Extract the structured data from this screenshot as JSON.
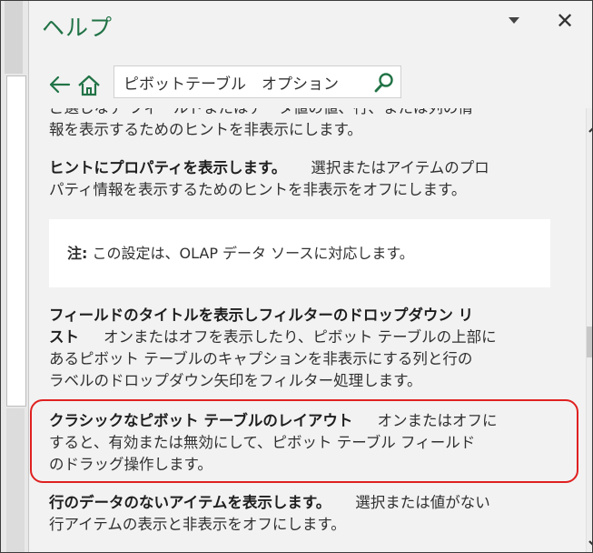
{
  "pane": {
    "title": "ヘルプ"
  },
  "search": {
    "value": "ピボットテーブル　オプション"
  },
  "content": {
    "para_top_line1": "ご選しなデ フィールドまたはデータ値の値、行、または列の情",
    "para_top_line2": "報を表示するためのヒントを非表示にします。",
    "hint_props_title": "ヒントにプロパティを表示します。",
    "hint_props_body_line1": "選択またはアイテムのプロ",
    "hint_props_body_line2": "パティ情報を表示するためのヒントを非表示をオフにします。",
    "note_label": "注:",
    "note_text": "この設定は、OLAP データ ソースに対応します。",
    "field_caption_title_line1": "フィールドのタイトルを表示しフィルターのドロップダウン リ",
    "field_caption_title_line2": "スト",
    "field_caption_body_line1": "オンまたはオフを表示したり、ピボット テーブルの上部に",
    "field_caption_body_line2": "あるピボット テーブルのキャプションを非表示にする列と行の",
    "field_caption_body_line3": "ラベルのドロップダウン矢印をフィルター処理します。",
    "classic_title": "クラシックなピボット テーブルのレイアウト",
    "classic_body_line1": "オンまたはオフに",
    "classic_body_line2": "すると、有効または無効にして、ピボット テーブル フィールド",
    "classic_body_line3": "のドラッグ操作します。",
    "empty_rows_title": "行のデータのないアイテムを表示します。",
    "empty_rows_body_line1": "選択または値がない",
    "empty_rows_body_line2": "行アイテムの表示と非表示をオフにします。"
  },
  "icons": {
    "back": "back-arrow-icon",
    "home": "home-icon",
    "search": "search-icon",
    "close": "close-icon",
    "menu": "chevron-down-icon",
    "scroll_up": "chevron-up-icon",
    "scroll_down": "chevron-down-icon"
  },
  "colors": {
    "title": "#217346",
    "highlight": "#e02020",
    "pane_bg": "#f2f2f2"
  }
}
